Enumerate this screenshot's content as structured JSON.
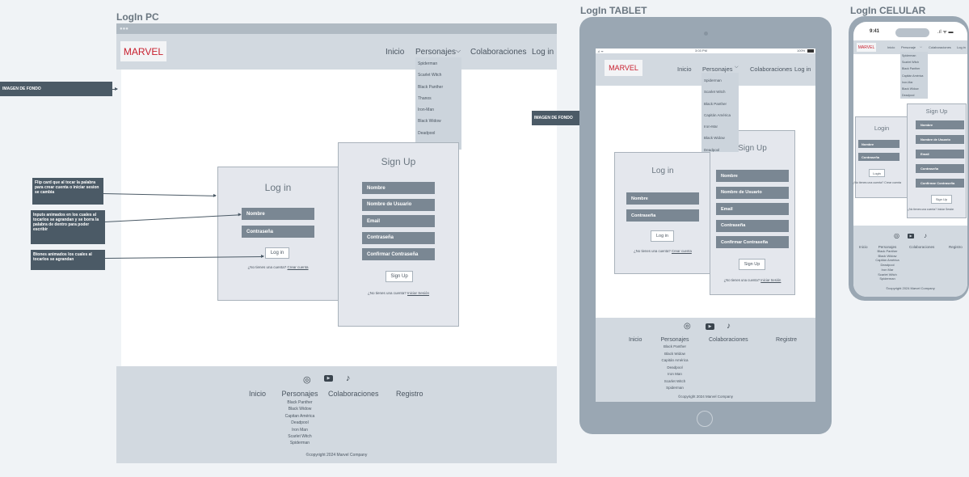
{
  "titles": {
    "pc": "LogIn PC",
    "tablet": "LogIn TABLET",
    "mobile": "LogIn CELULAR"
  },
  "brand": "MARVEL",
  "nav": {
    "inicio": "Inicio",
    "personajes": "Personajes",
    "colaboraciones": "Colaboraciones",
    "login": "Log in",
    "personajes_short": "Personaje"
  },
  "dropdown_pc": [
    "Spiderman",
    "Scarlet Witch",
    "Black Panther",
    "Thanos",
    "Iron-Man",
    "Black Widow",
    "Deadpool",
    "Hulk"
  ],
  "dropdown_tablet": [
    "Spiderman",
    "Scarlet Witch",
    "Black Panther",
    "Capitán América",
    "Iron-Mar",
    "Black Widow",
    "Deadpool"
  ],
  "dropdown_mobile": [
    "Spiderman",
    "Scarlet Witch",
    "Black Panther",
    "Capitán América",
    "Iron-Mar",
    "Black Widow",
    "Deadpool"
  ],
  "notes": {
    "bg": "IMAGEN DE FONDO",
    "flip": "Flip card que al tocar la palabra para crear cuenta o iniciar sesion se cambia",
    "inputs": "Inputs animados en los cuales al tocarlos se agrandan y se borra la palabra de dentro para poder escribir",
    "buttons": "Btones animados los cuales al tocarlos se agrandan"
  },
  "login": {
    "title": "Log in",
    "title_mobile": "Login",
    "nombre": "Nombre",
    "contrasena": "Contraseña",
    "button": "Log in",
    "button_mobile": "Login",
    "question": "¿No tienes una cuenta?",
    "link": "Crear cuenta"
  },
  "signup": {
    "title": "Sign Up",
    "fields": [
      "Nombre",
      "Nombre de Usuario",
      "Email",
      "Contraseña",
      "Confirmar Contraseña"
    ],
    "button": "Sign Up",
    "question": "¿No tienes una cuenta?",
    "link": "Iniciar Sesión"
  },
  "footer": {
    "inicio": "Inicio",
    "personajes": "Personajes",
    "colaboraciones": "Colaboraciones",
    "registro": "Registro",
    "registro_tablet": "Registre",
    "personajes_list": [
      "Black Panther",
      "Black Widow",
      "Capitan América",
      "Deadpool",
      "Iron Man",
      "Scarlet Witch",
      "Spiderman"
    ],
    "personajes_list_tablet": [
      "Black Panther",
      "Black Widow",
      "Capitán América",
      "Deadpool",
      "Iron Man",
      "Scarlet Witch",
      "Spiderman"
    ],
    "personajes_list_mobile": [
      "Black Panther",
      "Black Widow",
      "Capitán América",
      "Deadpool",
      "Iron Mar",
      "Scarlet Witch",
      "Spiderman"
    ],
    "copyright": "copyright 2024 Marvel Company"
  },
  "statusbar": {
    "time_mobile": "9:41",
    "time_tablet": "3:03 PM",
    "battery_tablet": "100%"
  },
  "colors": {
    "brand_red": "#c8202f",
    "header_bg": "#d2d9e0",
    "dark_field": "#7a8793",
    "device": "#9aa7b3",
    "note_bg": "#4b5a66"
  }
}
